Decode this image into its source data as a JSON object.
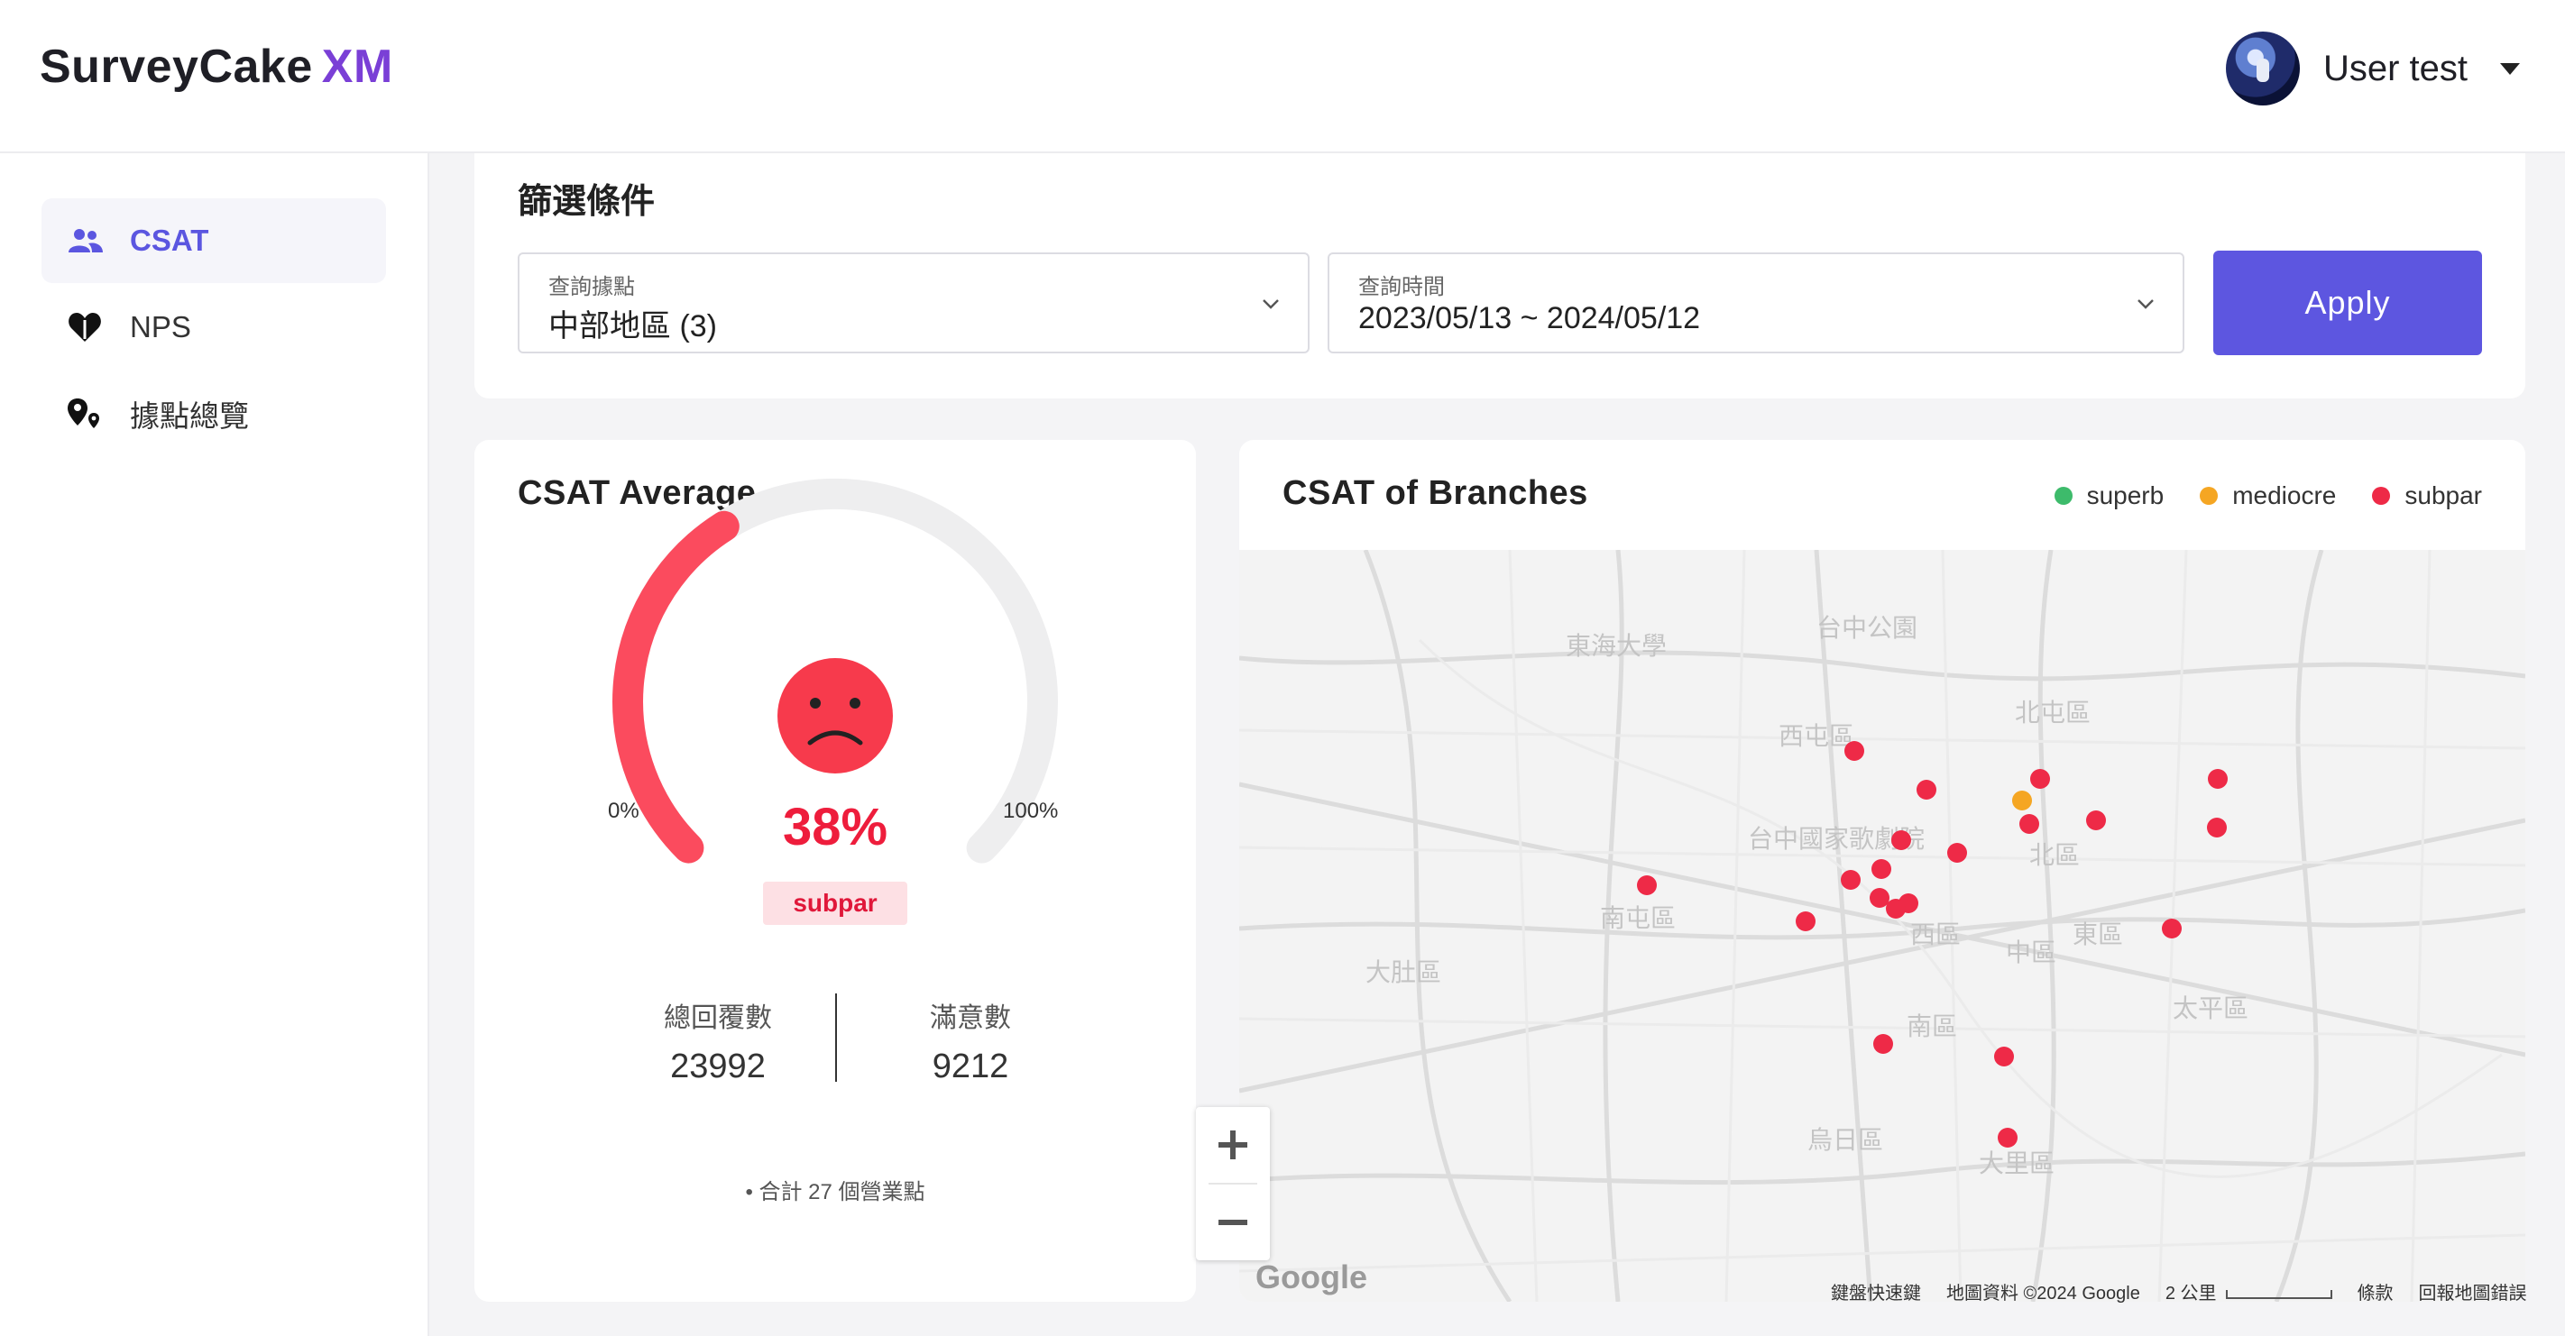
{
  "header": {
    "logo_main": "SurveyCake",
    "logo_suffix": "XM",
    "user_name": "User test"
  },
  "sidebar": {
    "items": [
      {
        "label": "CSAT",
        "icon": "people-icon",
        "active": true
      },
      {
        "label": "NPS",
        "icon": "heart-icon",
        "active": false
      },
      {
        "label": "據點總覽",
        "icon": "location-pin-icon",
        "active": false
      }
    ]
  },
  "filter": {
    "title": "篩選條件",
    "location_label": "查詢據點",
    "location_value": "中部地區 (3)",
    "time_label": "查詢時間",
    "time_value": "2023/05/13 ~ 2024/05/12",
    "apply_label": "Apply"
  },
  "csat_average": {
    "title": "CSAT Average",
    "percent_text": "38%",
    "percent_value": 0.38,
    "range_min": "0%",
    "range_max": "100%",
    "status": "subpar",
    "status_color": "#ee1d3c",
    "total_label": "總回覆數",
    "total_value": "23992",
    "satisfied_label": "滿意數",
    "satisfied_value": "9212",
    "footnote": "• 合計 27 個營業點"
  },
  "map_card": {
    "title": "CSAT of Branches",
    "legend": [
      {
        "label": "superb",
        "color": "#3dbb6b"
      },
      {
        "label": "mediocre",
        "color": "#f5a623"
      },
      {
        "label": "subpar",
        "color": "#ee2a47"
      }
    ],
    "place_labels": {
      "xitun": "西屯區",
      "beitun": "北屯區",
      "nantun": "南屯區",
      "dadu": "大肚區",
      "taiping": "太平區",
      "dali": "大里區",
      "wuri": "烏日區",
      "south": "南區",
      "west": "西區",
      "east": "東區",
      "central": "中區",
      "north": "北區",
      "park": "台中公園",
      "tunghai": "東海大學",
      "museum": "台中國家歌劇院"
    },
    "attribution": {
      "shortcuts": "鍵盤快速鍵",
      "data": "地圖資料 ©2024 Google",
      "scale": "2 公里",
      "terms": "條款",
      "report": "回報地圖錯誤"
    },
    "google_logo": "Google"
  }
}
